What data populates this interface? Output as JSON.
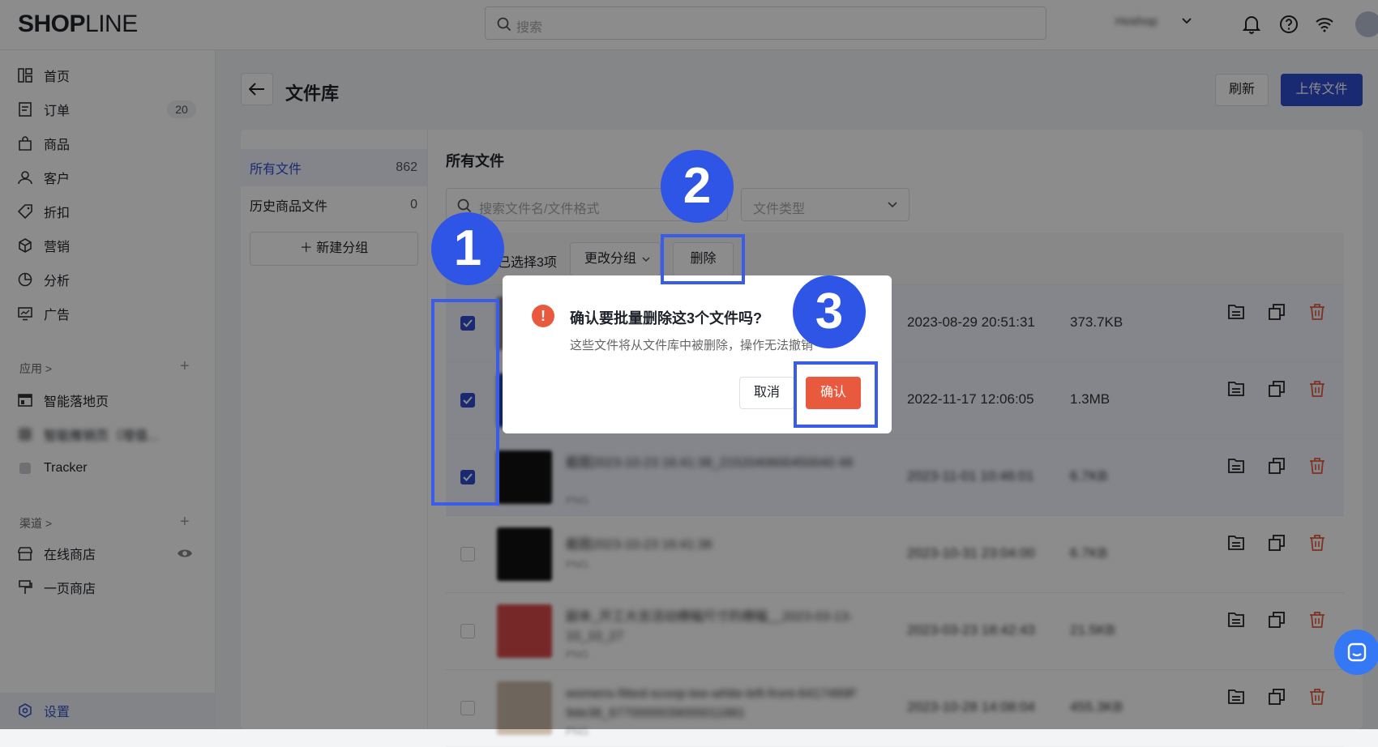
{
  "app": {
    "logo_bold": "SHOP",
    "logo_thin": "LINE",
    "search_placeholder": "搜索",
    "shop_name": "Hoshop"
  },
  "sidebar": {
    "items": [
      {
        "label": "首页"
      },
      {
        "label": "订单",
        "badge": "20"
      },
      {
        "label": "商品"
      },
      {
        "label": "客户"
      },
      {
        "label": "折扣"
      },
      {
        "label": "营销"
      },
      {
        "label": "分析"
      },
      {
        "label": "广告"
      }
    ],
    "apps_header": "应用 >",
    "apps": [
      {
        "label": "智能落地页"
      },
      {
        "label": "智能推销页（增值..."
      },
      {
        "label": "Tracker"
      }
    ],
    "channels_header": "渠道 >",
    "channels": [
      {
        "label": "在线商店"
      },
      {
        "label": "一页商店"
      }
    ],
    "settings": "设置"
  },
  "page": {
    "title": "文件库",
    "refresh": "刷新",
    "upload": "上传文件"
  },
  "groups": [
    {
      "label": "所有文件",
      "count": "862"
    },
    {
      "label": "历史商品文件",
      "count": "0"
    }
  ],
  "new_group": "＋  新建分组",
  "files_panel": {
    "title": "所有文件",
    "search_placeholder": "搜索文件名/文件格式",
    "type_placeholder": "文件类型",
    "selected_text": "已选择3项",
    "change_group": "更改分组",
    "delete": "删除"
  },
  "files": [
    {
      "name": "",
      "sub": "",
      "date": "2023-08-29 20:51:31",
      "size": "373.7KB",
      "checked": true
    },
    {
      "name": "",
      "sub": "",
      "date": "2022-11-17 12:06:05",
      "size": "1.3MB",
      "checked": true
    },
    {
      "name": "截图2023-10-23 16:41:38_2152040600450040 48",
      "sub": "PNG",
      "date": "2023-11-01 10:46:01",
      "size": "6.7KB",
      "checked": true
    },
    {
      "name": "截图2023-10-23 16:41:38",
      "sub": "PNG",
      "date": "2023-10-31 23:04:00",
      "size": "6.7KB",
      "checked": false
    },
    {
      "name": "副本_开工大吉活动横幅尺寸的横幅__2023-03-13-10_10_27",
      "sub": "PNG",
      "date": "2023-03-23 18:42:43",
      "size": "21.5KB",
      "checked": false
    },
    {
      "name": "womens-fitted-scoop-tee-white-left-front-6417489F 9de38_6770000039000011881",
      "sub": "PNG",
      "date": "2023-10-28 14:08:04",
      "size": "455.3KB",
      "checked": false
    }
  ],
  "dialog": {
    "icon": "!",
    "title": "确认要批量删除这3个文件吗?",
    "desc": "这些文件将从文件库中被删除，操作无法撤销",
    "cancel": "取消",
    "confirm": "确认"
  },
  "steps": [
    "1",
    "2",
    "3"
  ],
  "colors": {
    "primary": "#2f4bd0",
    "danger": "#e8593e",
    "highlight": "#3a5ce8"
  }
}
